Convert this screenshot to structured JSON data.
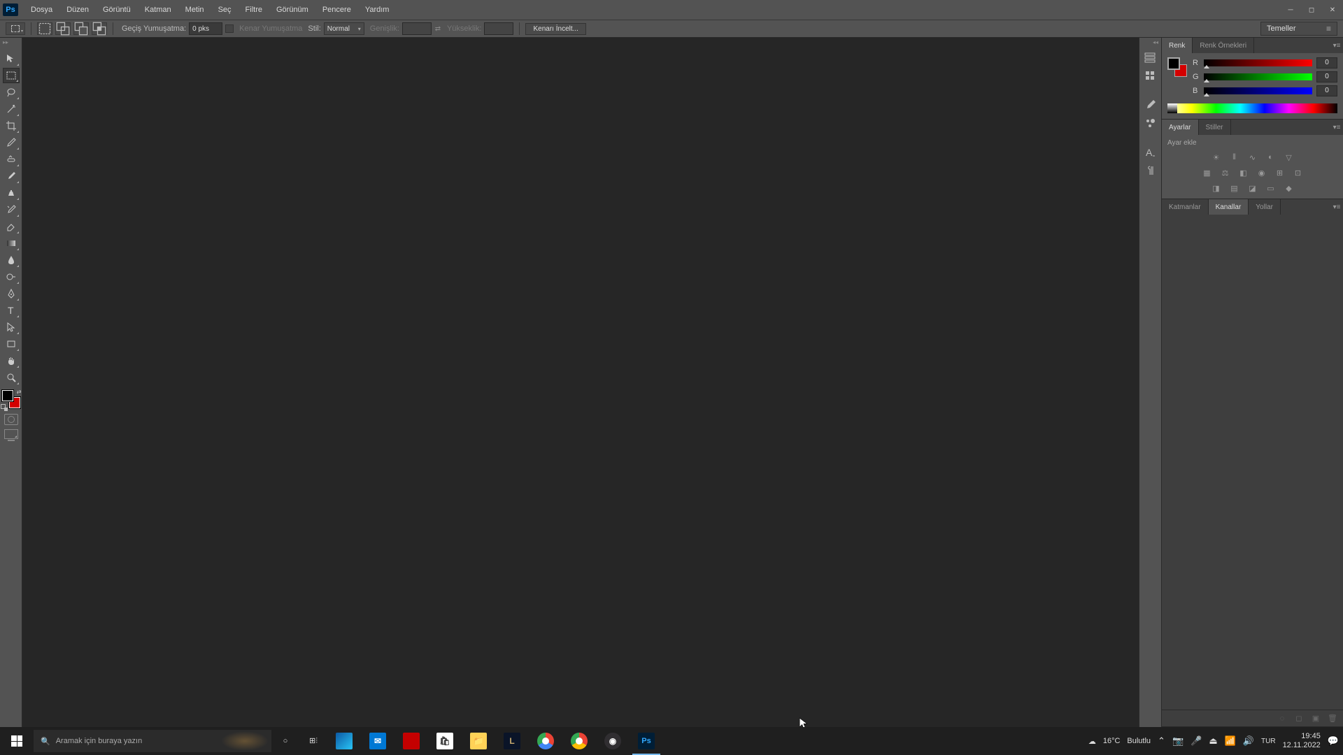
{
  "menubar": {
    "items": [
      "Dosya",
      "Düzen",
      "Görüntü",
      "Katman",
      "Metin",
      "Seç",
      "Filtre",
      "Görünüm",
      "Pencere",
      "Yardım"
    ]
  },
  "optionsbar": {
    "feather_label": "Geçiş Yumuşatma:",
    "feather_value": "0 pks",
    "antialias_label": "Kenar Yumuşatma",
    "style_label": "Stil:",
    "style_value": "Normal",
    "width_label": "Genişlik:",
    "height_label": "Yükseklik:",
    "refine_label": "Kenarı İncelt...",
    "workspace": "Temeller"
  },
  "panels": {
    "color": {
      "tabs": [
        "Renk",
        "Renk Örnekleri"
      ],
      "channels": [
        {
          "label": "R",
          "value": "0"
        },
        {
          "label": "G",
          "value": "0"
        },
        {
          "label": "B",
          "value": "0"
        }
      ],
      "fg_color": "#000000",
      "bg_color": "#d40000"
    },
    "adjustments": {
      "tabs": [
        "Ayarlar",
        "Stiller"
      ],
      "add_label": "Ayar ekle"
    },
    "layers": {
      "tabs": [
        "Katmanlar",
        "Kanallar",
        "Yollar"
      ],
      "active_tab": 1
    }
  },
  "toolbar": {
    "fg_color": "#000000",
    "bg_color": "#d40000"
  },
  "taskbar": {
    "search_placeholder": "Aramak için buraya yazın",
    "weather_temp": "16°C",
    "weather_cond": "Bulutlu",
    "time": "19:45",
    "date": "12.11.2022"
  }
}
